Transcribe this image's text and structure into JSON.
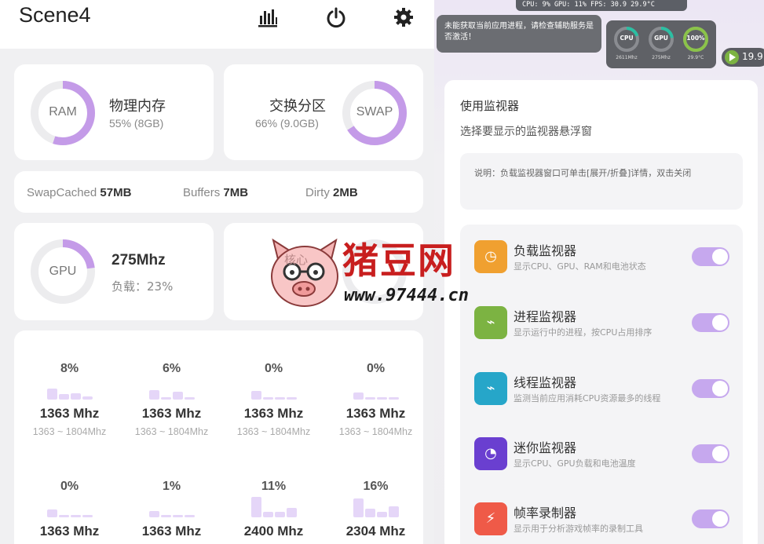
{
  "app": {
    "title": "Scene4",
    "toolbar_icons": [
      "bar-chart-icon",
      "power-icon",
      "gear-icon"
    ]
  },
  "memory": {
    "ram": {
      "ring_label": "RAM",
      "title": "物理内存",
      "detail": "55% (8GB)",
      "percent": 55
    },
    "swap": {
      "ring_label": "SWAP",
      "title": "交换分区",
      "detail": "66% (9.0GB)",
      "percent": 66
    }
  },
  "stats": [
    {
      "label": "SwapCached",
      "value": "57MB"
    },
    {
      "label": "Buffers",
      "value": "7MB"
    },
    {
      "label": "Dirty",
      "value": "2MB"
    }
  ],
  "gpu": {
    "ring_label": "GPU",
    "freq": "275Mhz",
    "load_label": "负载：23%",
    "percent": 23
  },
  "cores": [
    {
      "pct": "8%",
      "freq": "1363 Mhz",
      "range": "1363 ~ 1804Mhz",
      "bars": [
        0.9,
        0.45,
        0.55,
        0.25
      ]
    },
    {
      "pct": "6%",
      "freq": "1363 Mhz",
      "range": "1363 ~ 1804Mhz",
      "bars": [
        0.8,
        0.2,
        0.65,
        0.2
      ]
    },
    {
      "pct": "0%",
      "freq": "1363 Mhz",
      "range": "1363 ~ 1804Mhz",
      "bars": [
        0.7,
        0.2,
        0.2,
        0.2
      ]
    },
    {
      "pct": "0%",
      "freq": "1363 Mhz",
      "range": "1363 ~ 1804Mhz",
      "bars": [
        0.6,
        0.2,
        0.2,
        0.2
      ]
    },
    {
      "pct": "0%",
      "freq": "1363 Mhz",
      "range": "",
      "bars": [
        0.65,
        0.2,
        0.2,
        0.2
      ]
    },
    {
      "pct": "1%",
      "freq": "1363 Mhz",
      "range": "",
      "bars": [
        0.55,
        0.2,
        0.2,
        0.2
      ]
    },
    {
      "pct": "11%",
      "freq": "2400 Mhz",
      "range": "",
      "bars": [
        1.7,
        0.45,
        0.45,
        0.8
      ]
    },
    {
      "pct": "16%",
      "freq": "2304 Mhz",
      "range": "",
      "bars": [
        1.6,
        0.7,
        0.45,
        0.9
      ]
    }
  ],
  "overlay": {
    "top_bar": "CPU: 9%    GPU: 11%   FPS: 30.9   29.9°C",
    "toast": "未能获取当前应用进程，请检查辅助服务是否激活！",
    "mini": [
      {
        "label": "CPU",
        "sub": "2611Mhz",
        "percent": 20,
        "color": "#2bbfa3"
      },
      {
        "label": "GPU",
        "sub": "275Mhz",
        "percent": 23,
        "color": "#2bbfa3"
      },
      {
        "label": "100%",
        "sub": "29.9°C",
        "percent": 100,
        "color": "#8bc34a"
      }
    ],
    "fps": "19.9"
  },
  "sheet": {
    "title": "使用监视器",
    "subtitle": "选择要显示的监视器悬浮窗",
    "note": "说明：负载监视器窗口可单击[展开/折叠]详情，双击关闭",
    "monitors": [
      {
        "title": "负载监视器",
        "desc": "显示CPU、GPU、RAM和电池状态",
        "icon": "clock-icon",
        "color": "#f0a030",
        "enabled": true
      },
      {
        "title": "进程监视器",
        "desc": "显示运行中的进程，按CPU占用排序",
        "icon": "activity-icon",
        "color": "#7cb342",
        "enabled": true
      },
      {
        "title": "线程监视器",
        "desc": "监测当前应用消耗CPU资源最多的线程",
        "icon": "activity-icon",
        "color": "#26a6c9",
        "enabled": true
      },
      {
        "title": "迷你监视器",
        "desc": "显示CPU、GPU负载和电池温度",
        "icon": "gauge-icon",
        "color": "#6a3fd0",
        "enabled": true
      },
      {
        "title": "帧率录制器",
        "desc": "显示用于分析游戏帧率的录制工具",
        "icon": "runner-icon",
        "color": "#ef5a48",
        "enabled": true
      }
    ]
  },
  "watermark": {
    "text": "猪豆网",
    "badge": "核心",
    "url": "www.97444.cn"
  }
}
